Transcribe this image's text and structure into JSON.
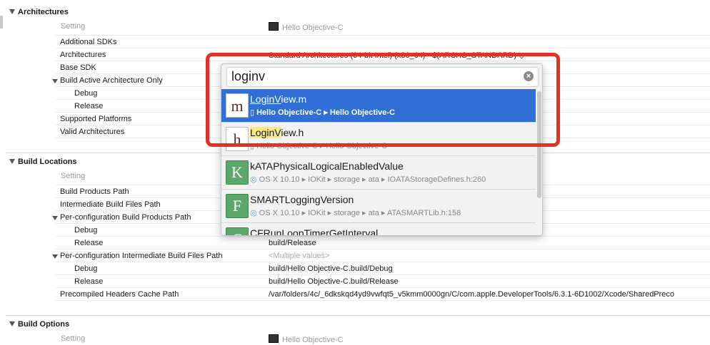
{
  "sections": {
    "architectures": "Architectures",
    "build_locations": "Build Locations",
    "build_options": "Build Options"
  },
  "columns": {
    "setting": "Setting",
    "target": "Hello Objective-C"
  },
  "arch_rows": [
    {
      "name": "Additional SDKs",
      "value": ""
    },
    {
      "name": "Architectures",
      "value": "Standard Architectures (64-bit Intel) (x86_64)  -  $(ARCHS_STANDARD) ◇"
    },
    {
      "name": "Base SDK",
      "value": ""
    },
    {
      "name": "Build Active Architecture Only",
      "value": ""
    },
    {
      "name": "Debug",
      "value": ""
    },
    {
      "name": "Release",
      "value": ""
    },
    {
      "name": "Supported Platforms",
      "value": ""
    },
    {
      "name": "Valid Architectures",
      "value": ""
    }
  ],
  "loc_rows": [
    {
      "name": "Build Products Path",
      "value": ""
    },
    {
      "name": "Intermediate Build Files Path",
      "value": ""
    },
    {
      "name": "Per-configuration Build Products Path",
      "value": ""
    },
    {
      "name": "Debug",
      "value": ""
    },
    {
      "name": "Release",
      "value": "build/Release"
    },
    {
      "name": "Per-configuration Intermediate Build Files Path",
      "value": "<Multiple values>"
    },
    {
      "name": "Debug",
      "value": "build/Hello Objective-C.build/Debug"
    },
    {
      "name": "Release",
      "value": "build/Hello Objective-C.build/Release"
    },
    {
      "name": "Precompiled Headers Cache Path",
      "value": "/var/folders/4c/_6dkskqd4yd9vwfqt5_v5kmm0000gn/C/com.apple.DeveloperTools/6.3.1-6D1002/Xcode/SharedPreco"
    }
  ],
  "search": {
    "query": "loginv"
  },
  "results": [
    {
      "icon": "m",
      "title_parts": [
        "",
        "Login",
        "V",
        "iew.m"
      ],
      "path": "Hello Objective-C ▸ Hello Objective-C"
    },
    {
      "icon": "h",
      "title_parts": [
        "",
        "Login",
        "V",
        "iew.h"
      ],
      "path": "Hello Objective-C ▸ Hello Objective-C"
    },
    {
      "icon": "K",
      "title": "kATAPhysicalLogicalEnabledValue",
      "path": "OS X 10.10 ▸ IOKit ▸ storage ▸ ata ▸ IOATAStorageDefines.h:260"
    },
    {
      "icon": "F",
      "title": "SMARTLoggingVersion",
      "path": "OS X 10.10 ▸ IOKit ▸ storage ▸ ata ▸ ATASMARTLib.h:158"
    },
    {
      "icon": "C",
      "title": "CFRunLoopTimerGetInterval",
      "path": ""
    }
  ],
  "colors": {
    "selection": "#2f6fd6",
    "highlight": "#f5e98a",
    "annotation": "#e53123"
  }
}
